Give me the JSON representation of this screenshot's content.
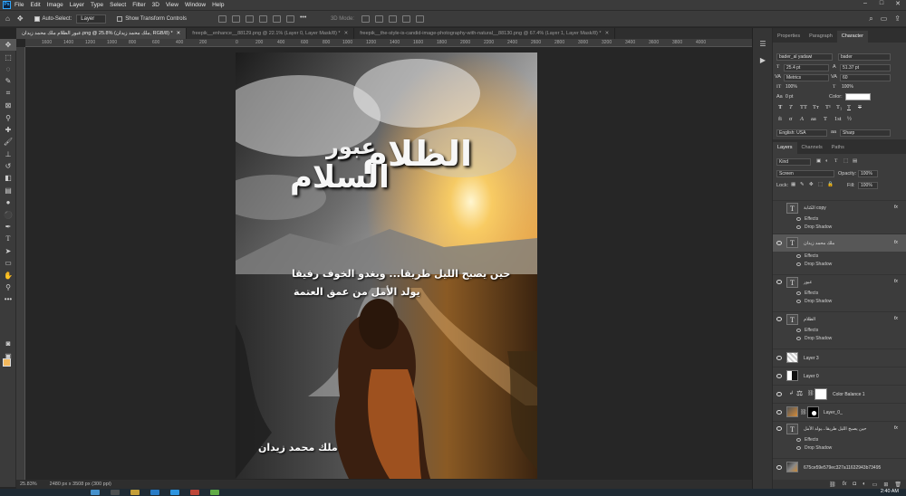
{
  "app": {
    "logo": "Ps",
    "menu": [
      "File",
      "Edit",
      "Image",
      "Layer",
      "Type",
      "Select",
      "Filter",
      "3D",
      "View",
      "Window",
      "Help"
    ]
  },
  "options": {
    "auto_select": "Auto-Select:",
    "layer_select": "Layer",
    "transform": "Show Transform Controls",
    "mode_label": "3D Mode:"
  },
  "tabs": [
    {
      "label": "عبور الظلام ملك محمد زيدان.png @ 25.8% (ملك محمد زيدان, RGB/8) *",
      "active": true
    },
    {
      "label": "freepik__enhance__88129.png @ 22.1% (Layer 0, Layer Mask/8) *",
      "active": false
    },
    {
      "label": "freepik__the-style-is-candid-image-photography-with-natural__88130.png @ 67.4% (Layer 1, Layer Mask/8) *",
      "active": false
    }
  ],
  "ruler": {
    "ticks": [
      "1600",
      "1400",
      "1200",
      "1000",
      "800",
      "600",
      "400",
      "200",
      "0",
      "200",
      "400",
      "600",
      "800",
      "1000",
      "1200",
      "1400",
      "1600",
      "1800",
      "2000",
      "2200",
      "2400",
      "2600",
      "2800",
      "3000",
      "3200",
      "3400",
      "3600",
      "3800",
      "4000"
    ]
  },
  "artwork": {
    "title_top": "عبور",
    "title_main": "الظلام",
    "title_sub": "السلام",
    "line1": "حين يصبح الليل طريقا... ويغدو الخوف رفيقا",
    "line2": "يولد الأمل من عمق العتمة",
    "author": "ملك محمد زيدان"
  },
  "status": {
    "zoom": "25.83%",
    "doc": "2480 px x 3508 px (300 ppi)"
  },
  "taskbar": {
    "clock": "2:40 AM"
  },
  "panel": {
    "top_tabs": [
      "Properties",
      "Paragraph",
      "Character"
    ],
    "font": "bader_al yadawi",
    "style": "bader",
    "size": "25.4 pt",
    "leading": "51.37 pt",
    "kerning": "Metrics",
    "tracking": "60",
    "vscale": "100%",
    "hscale": "100%",
    "baseline": "0 pt",
    "color_label": "Color:",
    "language": "English: USA",
    "aa": "Sharp",
    "layer_tabs": [
      "Layers",
      "Channels",
      "Paths"
    ],
    "kind": "Kind",
    "blend": "Screen",
    "opacity_label": "Opacity:",
    "opacity": "100%",
    "lock_label": "Lock:",
    "fill_label": "Fill:",
    "fill": "100%"
  },
  "layers": [
    {
      "name": "الكتابة copy",
      "type": "T",
      "fx": "fx",
      "effects": [
        "Effects",
        "Drop Shadow"
      ],
      "visible": false
    },
    {
      "name": "ملك محمد زيدان",
      "type": "T",
      "fx": "fx",
      "effects": [
        "Effects",
        "Drop Shadow"
      ],
      "visible": true,
      "selected": true
    },
    {
      "name": "عبور",
      "type": "T",
      "fx": "fx",
      "effects": [
        "Effects",
        "Drop Shadow"
      ],
      "visible": true
    },
    {
      "name": "الظلام",
      "type": "T",
      "fx": "fx",
      "effects": [
        "Effects",
        "Drop Shadow"
      ],
      "visible": true
    },
    {
      "name": "Layer 3",
      "type": "img",
      "visible": true
    },
    {
      "name": "Layer 0",
      "type": "img",
      "visible": true
    },
    {
      "name": "Color Balance 1",
      "type": "adj",
      "visible": true
    },
    {
      "name": "Layer_0_",
      "type": "img",
      "visible": true
    },
    {
      "name": "حين يصبح الليل طريقا...يولد الأمل",
      "type": "T",
      "fx": "fx",
      "effects": [
        "Effects",
        "Drop Shadow"
      ],
      "visible": true
    },
    {
      "name": "675ce59e579ec327a11632943b73495",
      "type": "img",
      "visible": true
    }
  ]
}
